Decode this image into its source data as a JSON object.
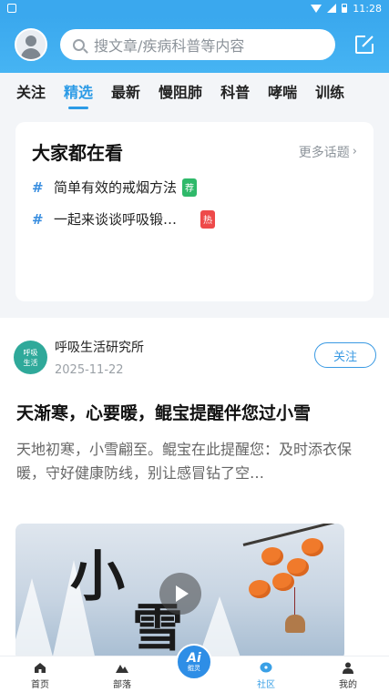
{
  "status_bar": {
    "time": "11:28"
  },
  "header": {
    "search_placeholder": "搜文章/疾病科普等内容"
  },
  "tabs": [
    {
      "label": "关注"
    },
    {
      "label": "精选",
      "active": true
    },
    {
      "label": "最新"
    },
    {
      "label": "慢阻肺"
    },
    {
      "label": "科普"
    },
    {
      "label": "哮喘"
    },
    {
      "label": "训练"
    }
  ],
  "trending": {
    "title": "大家都在看",
    "more_label": "更多话题",
    "topics": [
      {
        "hash": "#",
        "text": "简单有效的戒烟方法",
        "badge": "荐",
        "badge_color": "#2fb96a"
      },
      {
        "hash": "#",
        "text": "一起来谈谈呼吸锻…",
        "badge": "热",
        "badge_color": "#ee4a4a"
      }
    ]
  },
  "post": {
    "author": "呼吸生活研究所",
    "logo_text_line1": "呼吸",
    "logo_text_line2": "生活",
    "date": "2025-11-22",
    "follow_label": "关注",
    "title": "天渐寒，心要暖，鲲宝提醒伴您过小雪",
    "excerpt": "天地初寒，小雪翩至。鲲宝在此提醒您：及时添衣保暖，守好健康防线，别让感冒钻了空…",
    "image": {
      "char1": "小",
      "char2": "雪"
    }
  },
  "bottom_nav": {
    "items": [
      {
        "label": "首页",
        "icon": "home-icon"
      },
      {
        "label": "部落",
        "icon": "mountain-icon"
      },
      {
        "label": "社区",
        "icon": "community-icon",
        "active": true
      },
      {
        "label": "我的",
        "icon": "profile-icon"
      }
    ],
    "ai_label": "Ai",
    "ai_sub": "鲲灵"
  },
  "colors": {
    "header_blue": "#3aa8ee",
    "active_tab": "#2c9be6",
    "follow_blue": "#3a9ae3"
  }
}
